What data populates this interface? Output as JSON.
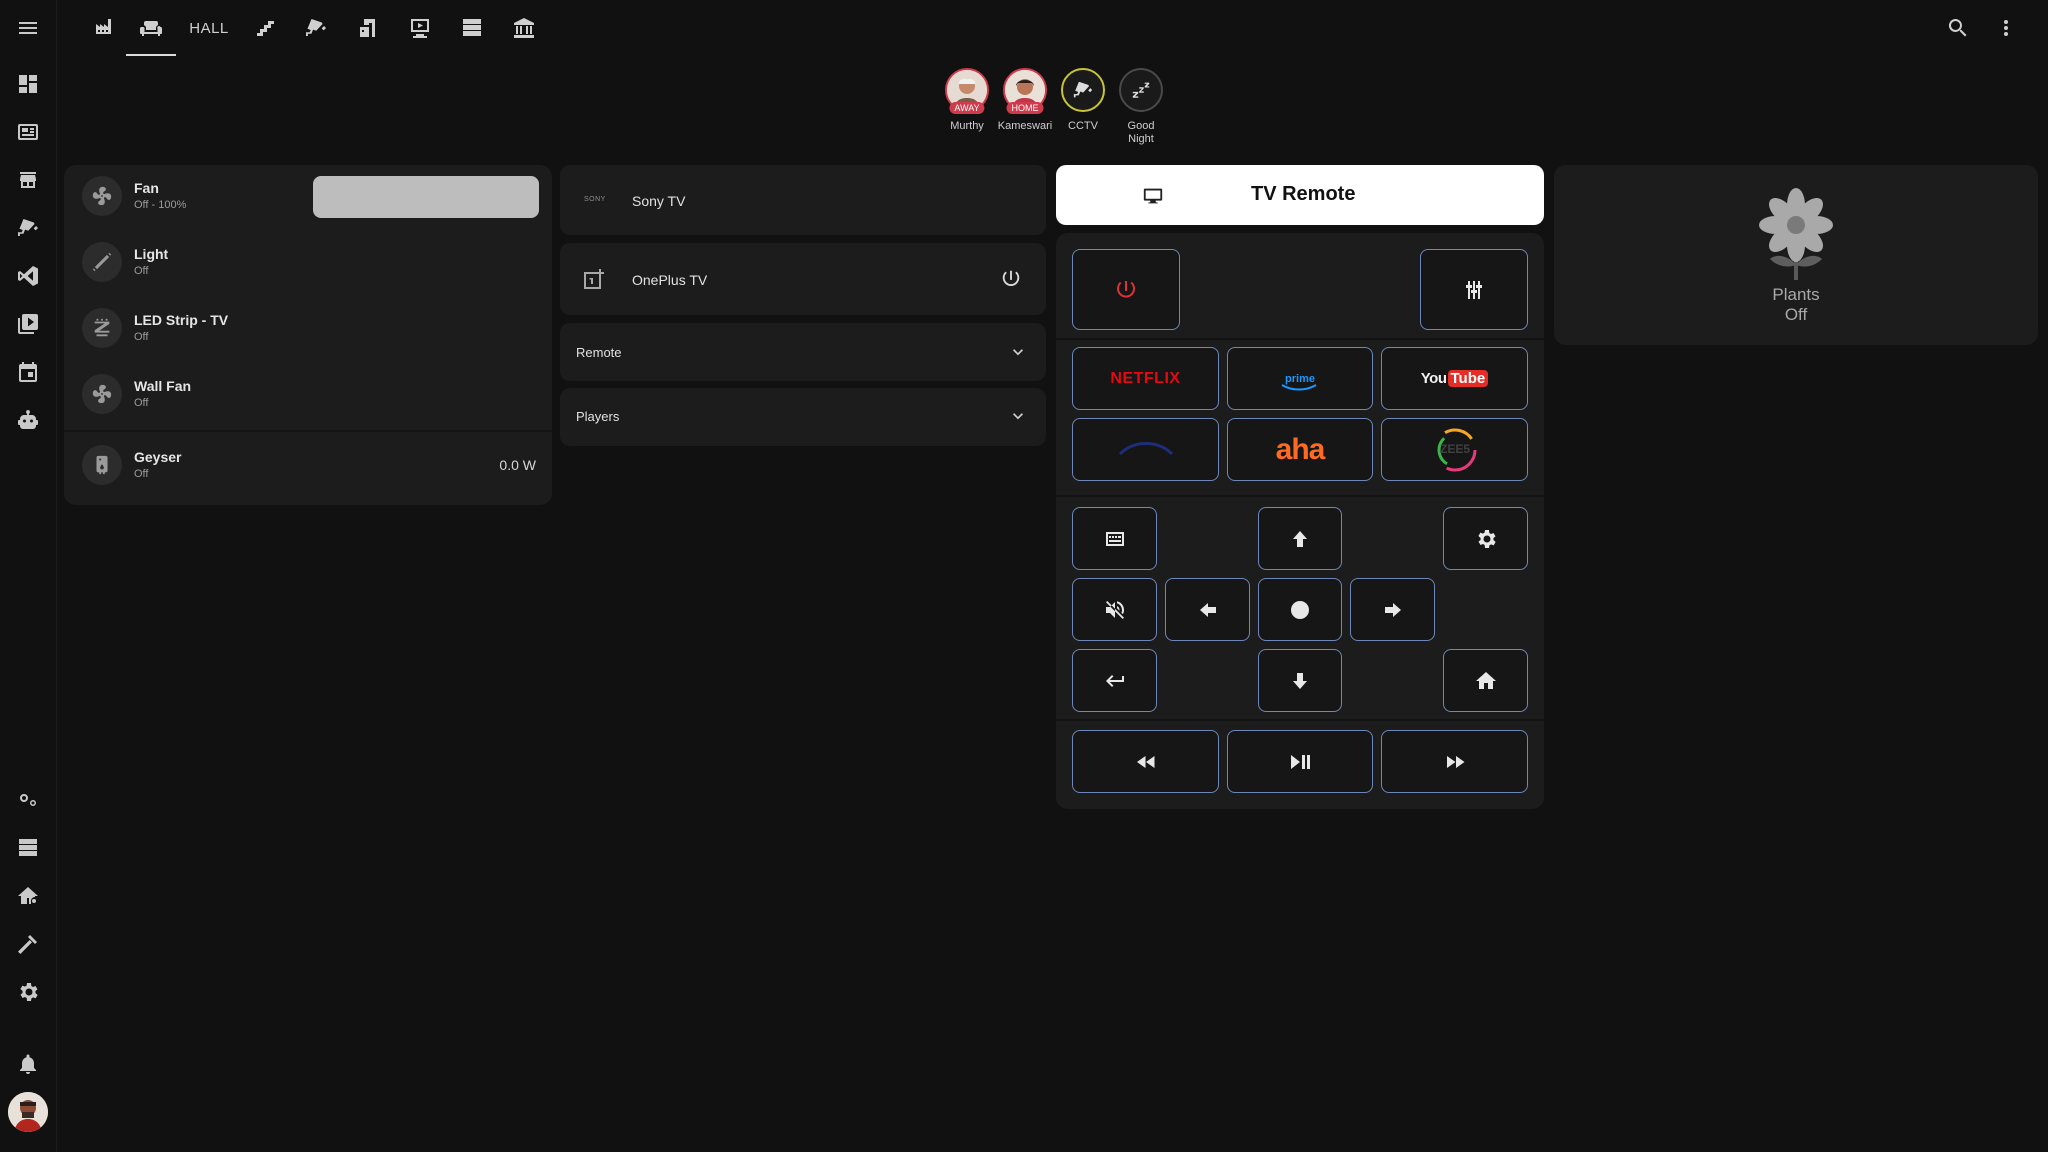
{
  "topbar": {
    "tabs": [
      {
        "name": "industry-icon"
      },
      {
        "name": "sofa-icon",
        "active": true
      },
      {
        "label": "HALL"
      },
      {
        "name": "stairs-icon"
      },
      {
        "name": "cctv-icon"
      },
      {
        "name": "door-icon"
      },
      {
        "name": "monitor-icon"
      },
      {
        "name": "server-icon"
      },
      {
        "name": "bank-icon"
      }
    ],
    "right": [
      "search-icon",
      "more-vertical-icon"
    ]
  },
  "sidebar": {
    "top_items": [
      "menu-icon",
      "dashboard-icon",
      "newspaper-icon",
      "hacs-icon",
      "cctv-icon",
      "vscode-icon",
      "media-icon",
      "calendar-icon",
      "robot-icon"
    ],
    "bottom_items": [
      "cog-multiple-icon",
      "server-icon",
      "home-cog-icon",
      "hammer-icon",
      "settings-icon",
      "bell-icon"
    ]
  },
  "badges": [
    {
      "label": "Murthy",
      "tag": "AWAY"
    },
    {
      "label": "Kameswari",
      "tag": "HOME"
    },
    {
      "label": "CCTV"
    },
    {
      "label": "Good Night"
    }
  ],
  "entities": [
    {
      "name": "Fan",
      "state": "Off - 100%",
      "icon": "fan-icon"
    },
    {
      "name": "Light",
      "state": "Off",
      "icon": "tube-light-icon"
    },
    {
      "name": "LED Strip - TV",
      "state": "Off",
      "icon": "led-strip-icon"
    },
    {
      "name": "Wall Fan",
      "state": "Off",
      "icon": "fan-icon"
    },
    {
      "name": "Geyser",
      "state": "Off",
      "value": "0.0 W",
      "icon": "water-heater-icon"
    }
  ],
  "media": {
    "sony_logo": "SONY",
    "sony": "Sony TV",
    "oneplus": "OnePlus TV",
    "remote": "Remote",
    "players": "Players"
  },
  "remote": {
    "title": "TV Remote",
    "apps": {
      "netflix": "NETFLIX",
      "prime": "prime",
      "youtube_you": "You",
      "youtube_tube": "Tube",
      "aha": "aha",
      "zee5": "ZEE5"
    }
  },
  "plants": {
    "name": "Plants",
    "state": "Off"
  },
  "colors": {
    "accent_red": "#d03b4c",
    "remote_border": "#6d87b8",
    "netflix": "#e50914",
    "prime": "#1a98ff",
    "aha": "#ff6a22"
  }
}
